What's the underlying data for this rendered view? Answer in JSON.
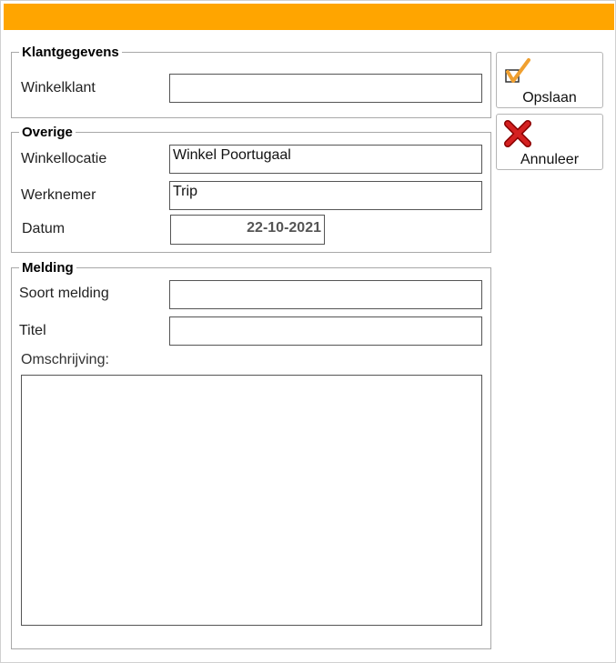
{
  "klantgegevens": {
    "legend": "Klantgegevens",
    "winkelklant_label": "Winkelklant",
    "winkelklant_value": ""
  },
  "overige": {
    "legend": "Overige",
    "winkellocatie_label": "Winkellocatie",
    "winkellocatie_value": "Winkel Poortugaal",
    "werknemer_label": "Werknemer",
    "werknemer_value": "Trip",
    "datum_label": "Datum",
    "datum_value": "22-10-2021"
  },
  "melding": {
    "legend": "Melding",
    "soort_label": "Soort melding",
    "soort_value": "",
    "titel_label": "Titel",
    "titel_value": "",
    "omschrijving_label": "Omschrijving:",
    "omschrijving_value": ""
  },
  "buttons": {
    "save_label": "Opslaan",
    "save_icon": "checkmark-icon",
    "cancel_label": "Annuleer",
    "cancel_icon": "red-x-icon"
  },
  "colors": {
    "titlebar": "#ffa500",
    "check": "#f0a030",
    "cancel": "#d42020"
  }
}
